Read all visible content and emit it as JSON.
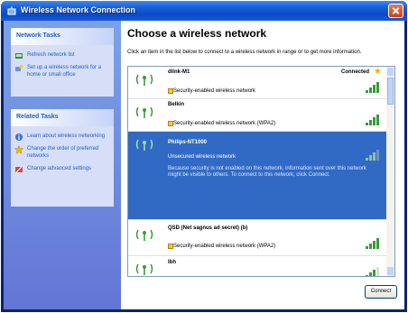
{
  "window": {
    "title": "Wireless Network Connection"
  },
  "sidebar": {
    "network_tasks": {
      "header": "Network Tasks",
      "items": [
        {
          "label": "Refresh network list",
          "icon": "refresh-icon"
        },
        {
          "label": "Set up a wireless network for a home or small office",
          "icon": "setup-network-icon"
        }
      ]
    },
    "related_tasks": {
      "header": "Related Tasks",
      "items": [
        {
          "label": "Learn about wireless networking",
          "icon": "info-icon"
        },
        {
          "label": "Change the order of preferred networks",
          "icon": "star-icon"
        },
        {
          "label": "Change advanced settings",
          "icon": "settings-icon"
        }
      ]
    }
  },
  "main": {
    "heading": "Choose a wireless network",
    "instructions": "Click an item in the list below to connect to a wireless network in range or to get more information.",
    "networks": [
      {
        "ssid": "dlink-M1",
        "security": "Security-enabled wireless network",
        "status": "Connected",
        "signal_bars": 4
      },
      {
        "ssid": "Belkin",
        "security": "Security-enabled wireless network (WPA2)",
        "status": "",
        "signal_bars": 4
      },
      {
        "ssid": "Philips-NT1000",
        "security": "Unsecured wireless network",
        "description": "Because security is not enabled on this network, information sent over this network might be visible to others. To connect to this network, click Connect.",
        "status": "",
        "signal_bars": 3
      },
      {
        "ssid": "QSD (Net sagnus ad secret) (b)",
        "security": "Security-enabled wireless network (WPA2)",
        "status": "",
        "signal_bars": 4
      },
      {
        "ssid": "Ibh",
        "security": "",
        "status": "",
        "signal_bars": 3
      }
    ],
    "connect_label": "Connect"
  },
  "colors": {
    "title_bar": "#0a49c8",
    "sidebar": "#7ba2e7",
    "selected_row": "#316ac5",
    "signal": "#3a9a3a"
  }
}
